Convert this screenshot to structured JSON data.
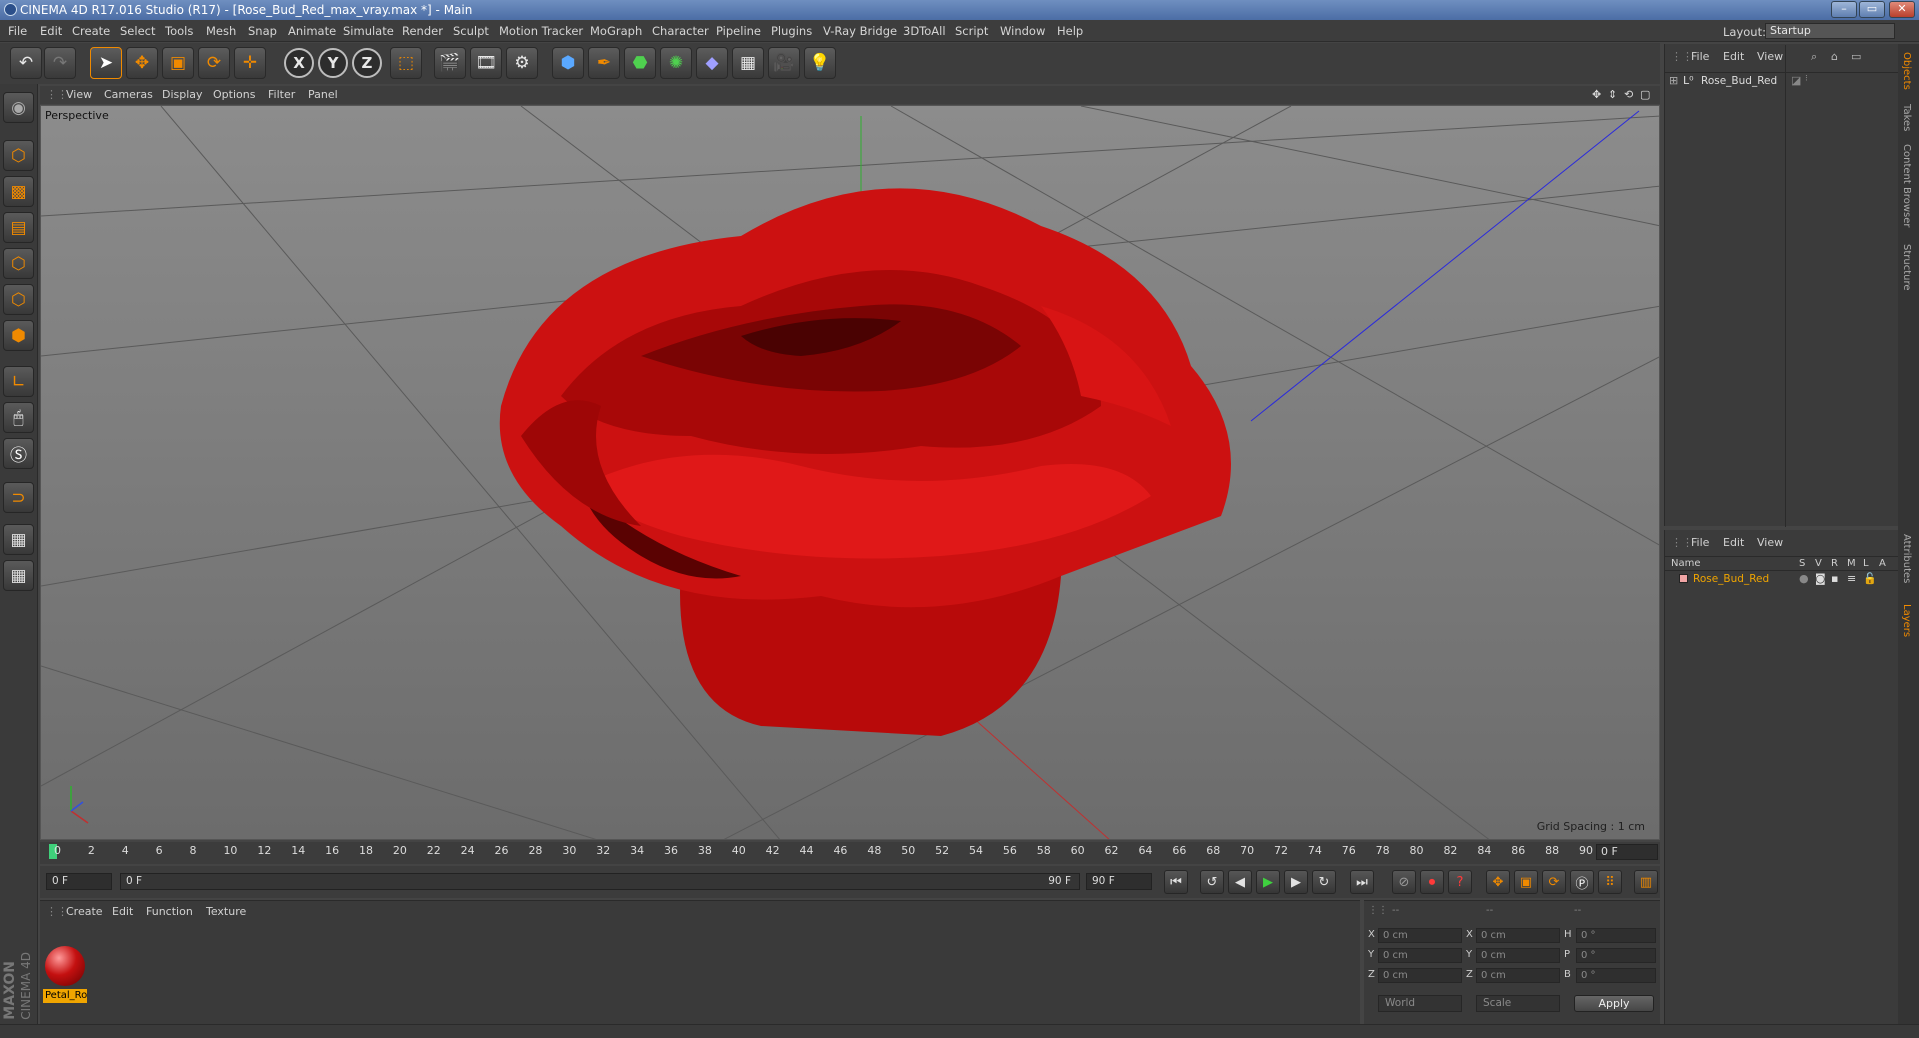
{
  "window": {
    "title": "CINEMA 4D R17.016 Studio (R17) - [Rose_Bud_Red_max_vray.max *] - Main",
    "controls": [
      "–",
      "▭",
      "✕"
    ]
  },
  "menubar": {
    "items": [
      "File",
      "Edit",
      "Create",
      "Select",
      "Tools",
      "Mesh",
      "Snap",
      "Animate",
      "Simulate",
      "Render",
      "Sculpt",
      "Motion Tracker",
      "MoGraph",
      "Character",
      "Pipeline",
      "Plugins",
      "V-Ray Bridge",
      "3DToAll",
      "Script",
      "Window",
      "Help"
    ],
    "layout_label": "Layout:",
    "layout_value": "Startup"
  },
  "toolbar": {
    "axis_x": "X",
    "axis_y": "Y",
    "axis_z": "Z"
  },
  "viewport": {
    "menu": [
      "View",
      "Cameras",
      "Display",
      "Options",
      "Filter",
      "Panel"
    ],
    "camera_label": "Perspective",
    "grid_spacing": "Grid Spacing : 1 cm",
    "background_top": "#8c8c8c",
    "background_bottom": "#6c6c6c"
  },
  "timeline": {
    "ticks": [
      "0",
      "2",
      "4",
      "6",
      "8",
      "10",
      "12",
      "14",
      "16",
      "18",
      "20",
      "22",
      "24",
      "26",
      "28",
      "30",
      "32",
      "34",
      "36",
      "38",
      "40",
      "42",
      "44",
      "46",
      "48",
      "50",
      "52",
      "54",
      "56",
      "58",
      "60",
      "62",
      "64",
      "66",
      "68",
      "70",
      "72",
      "74",
      "76",
      "78",
      "80",
      "82",
      "84",
      "86",
      "88",
      "90"
    ],
    "current_frame": "0 F",
    "start_field": "0 F",
    "range_start": "0 F",
    "range_end": "90 F",
    "end_field": "90 F"
  },
  "materials": {
    "menu": [
      "Create",
      "Edit",
      "Function",
      "Texture"
    ],
    "items": [
      {
        "name": "Petal_Ro"
      }
    ],
    "selected_color": "#f0a500"
  },
  "coordinates": {
    "headers": [
      "--",
      "--",
      "--"
    ],
    "rows": [
      {
        "pos_label": "X",
        "pos_value": "0 cm",
        "size_label": "X",
        "size_value": "0 cm",
        "rot_label": "H",
        "rot_value": "0 °"
      },
      {
        "pos_label": "Y",
        "pos_value": "0 cm",
        "size_label": "Y",
        "size_value": "0 cm",
        "rot_label": "P",
        "rot_value": "0 °"
      },
      {
        "pos_label": "Z",
        "pos_value": "0 cm",
        "size_label": "Z",
        "size_value": "0 cm",
        "rot_label": "B",
        "rot_value": "0 °"
      }
    ],
    "mode_world": "World",
    "mode_scale": "Scale",
    "apply_label": "Apply"
  },
  "objects_panel": {
    "menu": [
      "File",
      "Edit",
      "View"
    ],
    "items": [
      {
        "name": "Rose_Bud_Red"
      }
    ]
  },
  "layers_panel": {
    "menu": [
      "File",
      "Edit",
      "View"
    ],
    "columns": [
      "Name",
      "S",
      "V",
      "R",
      "M",
      "L",
      "A"
    ],
    "items": [
      {
        "name": "Rose_Bud_Red",
        "color": "#f0a500"
      }
    ]
  },
  "side_tabs": [
    "Objects",
    "Takes",
    "Content Browser",
    "Structure",
    "Attributes",
    "Layers"
  ],
  "brand": {
    "line1": "MAXON",
    "line2": "CINEMA 4D"
  },
  "accent_color": "#f08a00"
}
